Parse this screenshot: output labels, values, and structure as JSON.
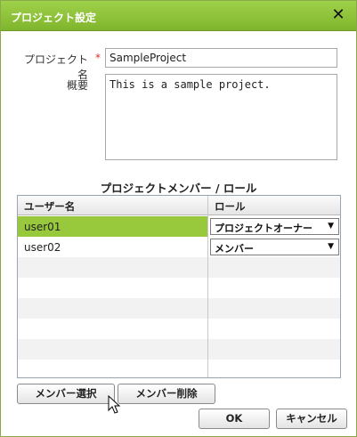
{
  "dialog": {
    "title": "プロジェクト設定",
    "close_icon": "close-icon"
  },
  "form": {
    "project_name_label": "プロジェクト名",
    "required_mark": "*",
    "project_name_value": "SampleProject",
    "summary_label": "概要",
    "summary_value": "This is a sample project."
  },
  "members": {
    "section_title": "プロジェクトメンバー / ロール",
    "columns": [
      "ユーザー名",
      "ロール"
    ],
    "rows": [
      {
        "user": "user01",
        "role": "プロジェクトオーナー",
        "selected": true
      },
      {
        "user": "user02",
        "role": "メンバー",
        "selected": false
      }
    ],
    "dropdown_icon": "chevron-down-icon"
  },
  "buttons": {
    "select_members": "メンバー選択",
    "remove_member": "メンバー削除",
    "ok": "OK",
    "cancel": "キャンセル"
  },
  "colors": {
    "accent": "#8cc63e",
    "selected_row": "#98c93c",
    "required": "#d9302a"
  }
}
